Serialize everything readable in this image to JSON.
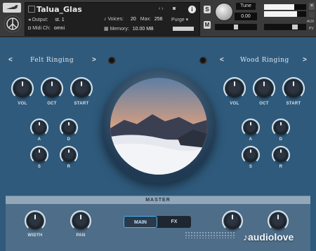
{
  "header": {
    "instrument_name": "Talua_Glas",
    "output_label": "Output:",
    "output_value": "st. 1",
    "midi_label": "Midi Ch:",
    "midi_value": "omni",
    "voices_label": "Voices:",
    "voices_value": "20",
    "max_label": "Max:",
    "max_value": "256",
    "memory_label": "Memory:",
    "memory_value": "10.00 MB",
    "purge_label": "Purge",
    "s_button": "S",
    "m_button": "M",
    "tune_label": "Tune",
    "tune_value": "0.00",
    "aux_label": "AUX",
    "pv_label": "PV",
    "meter_left_level": 0.72,
    "meter_right_level": 0.78,
    "colors": {
      "header_bg": "#3a3a3a",
      "panel_bg": "#2f5a7c"
    }
  },
  "left_panel": {
    "prev": "<",
    "next": ">",
    "title": "Felt Ringing",
    "knobs": {
      "vol": "VOL",
      "oct": "OCT",
      "start": "START",
      "a": "A",
      "d": "D",
      "s": "S",
      "r": "R"
    }
  },
  "right_panel": {
    "prev": "<",
    "next": ">",
    "title": "Wood Ringing",
    "knobs": {
      "vol": "VOL",
      "oct": "OCT",
      "start": "START",
      "a": "A",
      "d": "D",
      "s": "S",
      "r": "R"
    }
  },
  "master": {
    "title": "MASTER",
    "width_label": "WIDTH",
    "pan_label": "PAN",
    "tabs": [
      "MAIN",
      "FX"
    ],
    "active_tab": "MAIN"
  },
  "watermark": "audiolove"
}
